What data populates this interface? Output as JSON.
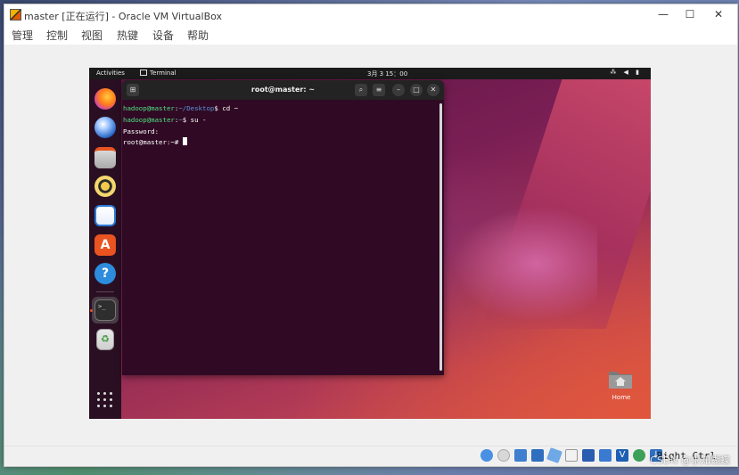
{
  "window": {
    "title": "master [正在运行] - Oracle VM VirtualBox",
    "controls": {
      "minimize": "—",
      "maximize": "☐",
      "close": "✕"
    }
  },
  "menu": [
    "管理",
    "控制",
    "视图",
    "热键",
    "设备",
    "帮助"
  ],
  "guest": {
    "topbar": {
      "activities": "Activities",
      "app_name": "Terminal",
      "clock": "3月 3  15：00",
      "system_icons": "⁂ ◀ ▮"
    },
    "dock": [
      {
        "name": "Firefox"
      },
      {
        "name": "Thunderbird"
      },
      {
        "name": "Files"
      },
      {
        "name": "Rhythmbox"
      },
      {
        "name": "LibreOffice Writer"
      },
      {
        "name": "Ubuntu Software"
      },
      {
        "name": "Help"
      },
      {
        "name": "Terminal",
        "active": true
      },
      {
        "name": "Trash"
      }
    ],
    "terminal": {
      "title": "root@master: ~",
      "lines": [
        {
          "user": "hadoop@master",
          "sep": ":",
          "path": "~/Desktop",
          "prompt": "$ ",
          "cmd": "cd ~"
        },
        {
          "user": "hadoop@master",
          "sep": ":",
          "path": "~",
          "prompt": "$ ",
          "cmd": "su -"
        },
        {
          "text": "Password:"
        },
        {
          "text": "root@master:~# "
        }
      ]
    },
    "desktop": {
      "home_label": "Home"
    }
  },
  "statusbar": {
    "host_key": "Right Ctrl"
  },
  "watermark": "CSDN @求知蝴蝶"
}
